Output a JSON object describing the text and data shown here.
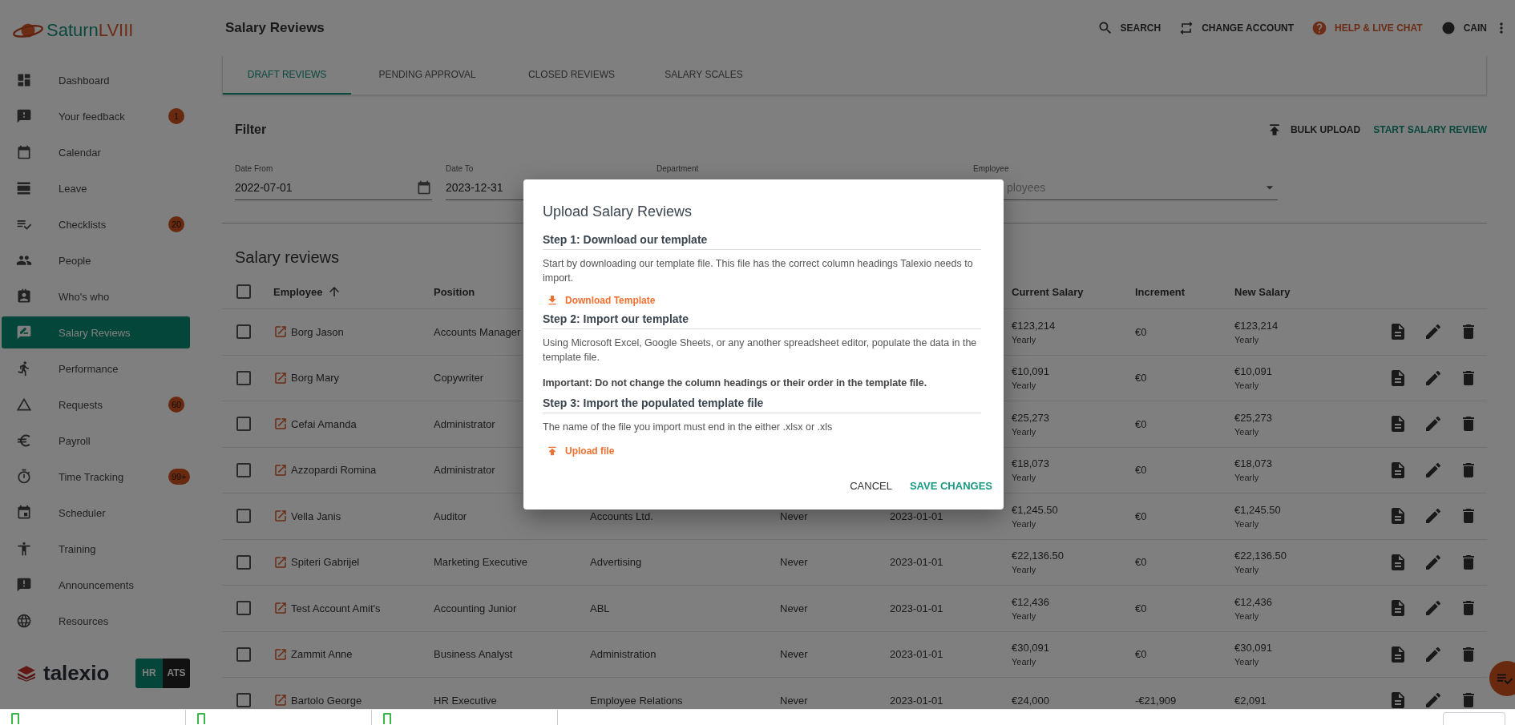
{
  "brand": {
    "name_main": "Saturn",
    "name_accent": "LVIII"
  },
  "sidebar": {
    "items": [
      {
        "label": "Dashboard",
        "selected": false
      },
      {
        "label": "Your feedback",
        "badge": "1",
        "selected": false
      },
      {
        "label": "Calendar",
        "selected": false
      },
      {
        "label": "Leave",
        "selected": false
      },
      {
        "label": "Checklists",
        "badge": "20",
        "selected": false
      },
      {
        "label": "People",
        "selected": false
      },
      {
        "label": "Who's who",
        "selected": false
      },
      {
        "label": "Salary Reviews",
        "selected": true
      },
      {
        "label": "Performance",
        "selected": false
      },
      {
        "label": "Requests",
        "badge": "60",
        "selected": false
      },
      {
        "label": "Payroll",
        "selected": false
      },
      {
        "label": "Time Tracking",
        "badge": "99+",
        "selected": false
      },
      {
        "label": "Scheduler",
        "selected": false
      },
      {
        "label": "Training",
        "selected": false
      },
      {
        "label": "Announcements",
        "selected": false
      },
      {
        "label": "Resources",
        "selected": false
      }
    ]
  },
  "footer": {
    "brand": "talexio",
    "switch": [
      {
        "label": "HR",
        "selected": true
      },
      {
        "label": "ATS",
        "selected": false
      }
    ]
  },
  "header": {
    "title": "Salary Reviews",
    "actions": [
      {
        "kind": "search",
        "label": "SEARCH"
      },
      {
        "kind": "swap",
        "label": "CHANGE ACCOUNT"
      },
      {
        "kind": "help",
        "label": "HELP & LIVE CHAT"
      },
      {
        "kind": "user",
        "label": "CAIN"
      }
    ]
  },
  "tabs": [
    {
      "label": "DRAFT REVIEWS",
      "selected": true
    },
    {
      "label": "PENDING APPROVAL",
      "selected": false
    },
    {
      "label": "CLOSED REVIEWS",
      "selected": false
    },
    {
      "label": "SALARY SCALES",
      "selected": false
    }
  ],
  "filter": {
    "title": "Filter",
    "actions": [
      {
        "kind": "upload",
        "label": "BULK UPLOAD"
      },
      {
        "kind": "primary",
        "label": "START SALARY REVIEW"
      }
    ],
    "fields": [
      {
        "label": "Date From",
        "value": "2022-07-01",
        "kind": "date"
      },
      {
        "label": "Date To",
        "value": "2023-12-31"
      },
      {
        "label": "Department"
      },
      {
        "label": "Employee",
        "placeholder": "ployees",
        "kind": "select"
      }
    ]
  },
  "table": {
    "title": "Salary reviews",
    "all_checked": false,
    "columns": [
      {
        "label": "Employee",
        "sorted": true
      },
      {
        "label": "Position",
        "sorted": false
      },
      {
        "label": "Current Salary",
        "sorted": false
      },
      {
        "label": "Increment",
        "sorted": false
      },
      {
        "label": "New Salary",
        "sorted": false
      }
    ],
    "rows": [
      {
        "checked": false,
        "employee": "Borg Jason",
        "position": "Accounts Manager",
        "current": "€123,214",
        "current_period": "Yearly",
        "increment": "€0",
        "new": "€123,214",
        "new_period": "Yearly"
      },
      {
        "checked": false,
        "employee": "Borg Mary",
        "position": "Copywriter",
        "current": "€10,091",
        "current_period": "Yearly",
        "increment": "€0",
        "new": "€10,091",
        "new_period": "Yearly"
      },
      {
        "checked": false,
        "employee": "Cefai Amanda",
        "position": "Administrator",
        "current": "€25,273",
        "current_period": "Yearly",
        "increment": "€0",
        "new": "€25,273",
        "new_period": "Yearly"
      },
      {
        "checked": false,
        "employee": "Azzopardi Romina",
        "position": "Administrator",
        "current": "€18,073",
        "current_period": "Yearly",
        "increment": "€0",
        "new": "€18,073",
        "new_period": "Yearly"
      },
      {
        "checked": false,
        "employee": "Vella Janis",
        "position": "Auditor",
        "department": "Accounts Ltd.",
        "frequency": "Never",
        "date": "2023-01-01",
        "current": "€1,245.50",
        "current_period": "Yearly",
        "increment": "€0",
        "new": "€1,245.50",
        "new_period": "Yearly"
      },
      {
        "checked": false,
        "employee": "Spiteri Gabrijel",
        "position": "Marketing Executive",
        "department": "Advertising",
        "frequency": "Never",
        "date": "2023-01-01",
        "current": "€22,136.50",
        "current_period": "Yearly",
        "increment": "€0",
        "new": "€22,136.50",
        "new_period": "Yearly"
      },
      {
        "checked": false,
        "employee": "Test Account Amit's",
        "position": "Accounting Junior",
        "department": "ABL",
        "frequency": "Never",
        "date": "2023-01-01",
        "current": "€12,436",
        "current_period": "Yearly",
        "increment": "€0",
        "new": "€12,436",
        "new_period": "Yearly"
      },
      {
        "checked": false,
        "employee": "Zammit Anne",
        "position": "Business Analyst",
        "department": "Administration",
        "frequency": "Never",
        "date": "2023-01-01",
        "current": "€30,091",
        "current_period": "Yearly",
        "increment": "€0",
        "new": "€30,091",
        "new_period": "Yearly"
      },
      {
        "checked": false,
        "employee": "Bartolo George",
        "position": "HR Executive",
        "department": "Employee Relations",
        "frequency": "Never",
        "date": "2023-01-01",
        "current": "€24,000",
        "increment": "-€21,909",
        "new": "€2,091"
      }
    ]
  },
  "dialog": {
    "title": "Upload Salary Reviews",
    "steps": [
      {
        "heading": "Step 1: Download our template",
        "paragraphs": [
          {
            "kind": "text",
            "text": "Start by downloading our template file. This file has the correct column headings Talexio needs to import."
          }
        ],
        "action": {
          "kind": "download",
          "label": "Download Template"
        }
      },
      {
        "heading": "Step 2: Import our template",
        "paragraphs": [
          {
            "kind": "text",
            "text": "Using Microsoft Excel, Google Sheets, or any another spreadsheet editor, populate the data in the template file."
          },
          {
            "kind": "important",
            "text": "Important: Do not change the column headings or their order in the template file."
          }
        ]
      },
      {
        "heading": "Step 3: Import the populated template file",
        "paragraphs": [
          {
            "kind": "text",
            "text": "The name of the file you import must end in the either .xlsx or .xls"
          }
        ],
        "action": {
          "kind": "upload",
          "label": "Upload file"
        }
      }
    ],
    "buttons": [
      {
        "kind": "secondary",
        "label": "CANCEL"
      },
      {
        "kind": "primary",
        "label": "SAVE CHANGES"
      }
    ]
  }
}
